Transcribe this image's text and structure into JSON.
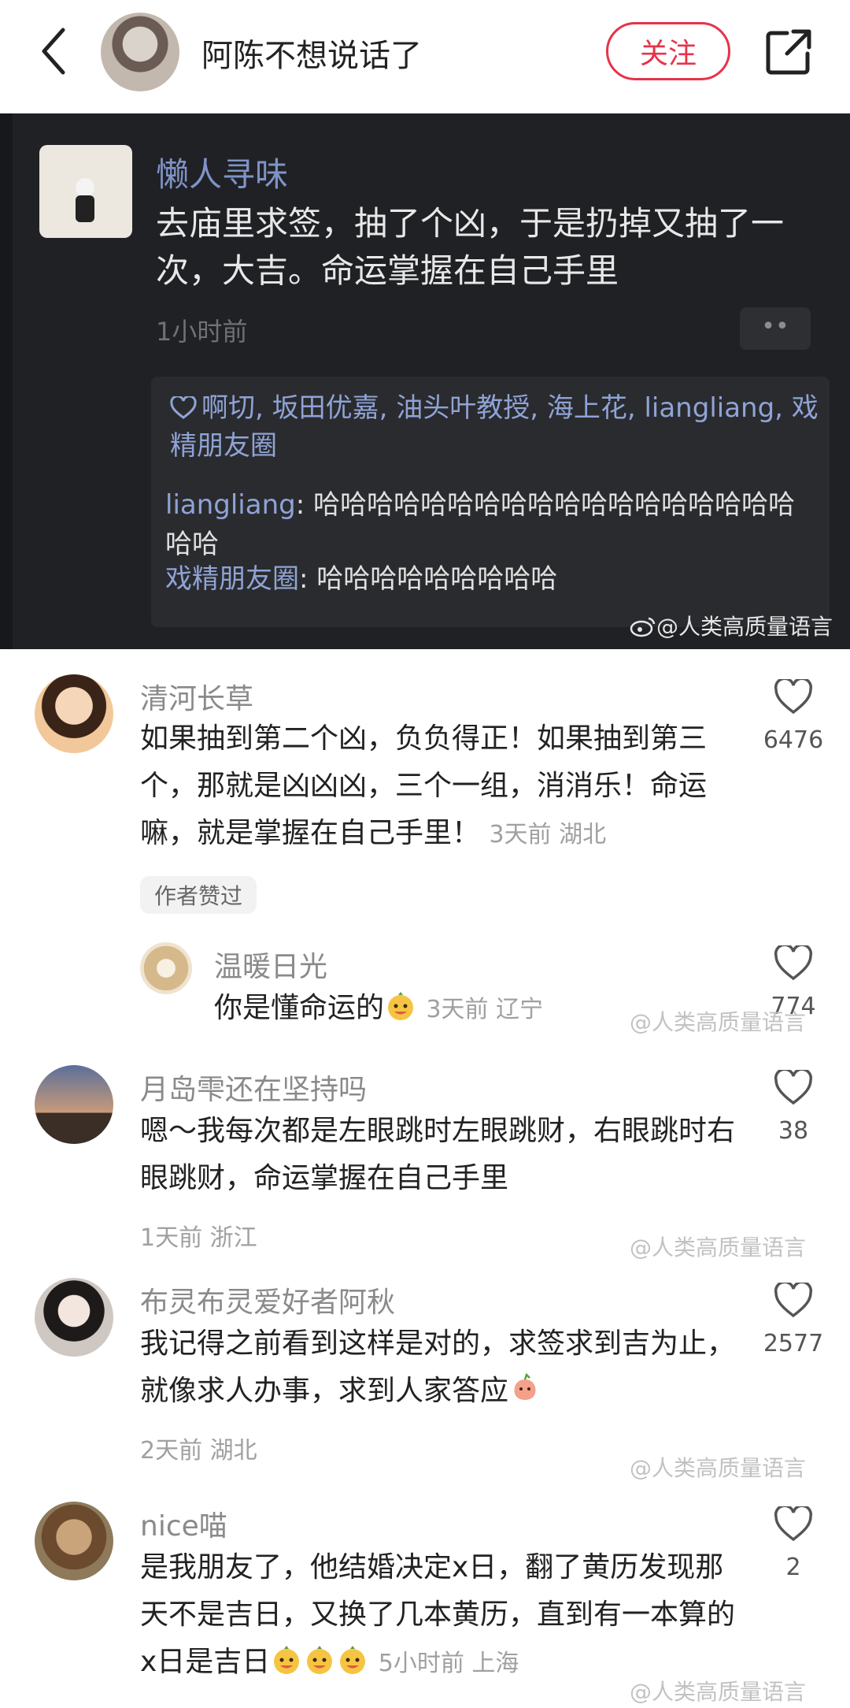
{
  "header": {
    "title": "阿陈不想说话了",
    "follow_label": "关注"
  },
  "post": {
    "author": "懒人寻味",
    "text": "去庙里求签，抽了个凶，于是扔掉又抽了一次，大吉。命运掌握在自己手里",
    "time": "1小时前",
    "more": "••",
    "likes": "啊切, 坂田优嘉, 油头叶教授, 海上花, liangliang, 戏精朋友圈",
    "comments": [
      {
        "user": "liangliang",
        "sep": ": ",
        "text": "哈哈哈哈哈哈哈哈哈哈哈哈哈哈哈哈哈哈哈哈"
      },
      {
        "user": "戏精朋友圈",
        "sep": ": ",
        "text": "哈哈哈哈哈哈哈哈哈"
      }
    ]
  },
  "watermark": "@人类高质量语言",
  "comments": [
    {
      "name": "清河长草",
      "text": "如果抽到第二个凶，负负得正！如果抽到第三个，那就是凶凶凶，三个一组，消消乐！命运嘛，就是掌握在自己手里！",
      "meta": "3天前 湖北",
      "likes": "6476",
      "badge": "作者赞过"
    },
    {
      "name": "温暖日光",
      "text": "你是懂命运的",
      "meta": "3天前 辽宁",
      "likes": "774"
    },
    {
      "name": "月岛雫还在坚持吗",
      "text": "嗯～我每次都是左眼跳时左眼跳财，右眼跳时右眼跳财，命运掌握在自己手里",
      "meta": "1天前 浙江",
      "likes": "38"
    },
    {
      "name": "布灵布灵爱好者阿秋",
      "text": "我记得之前看到这样是对的，求签求到吉为止，就像求人办事，求到人家答应",
      "meta": "2天前 湖北",
      "likes": "2577"
    },
    {
      "name": "nice喵",
      "text": "是我朋友了，他结婚决定x日，翻了黄历发现那天不是吉日，又换了几本黄历，直到有一本算的x日是吉日",
      "meta": "5小时前 上海",
      "likes": "2"
    }
  ],
  "icons": [
    "back-chevron-icon",
    "share-icon",
    "heart-icon",
    "weibo-icon",
    "smile-emoji-icon",
    "peach-emoji-icon"
  ],
  "colors": {
    "accent": "#e6334a",
    "dark_bg": "#202124",
    "link_blue": "#8fa3d6"
  }
}
